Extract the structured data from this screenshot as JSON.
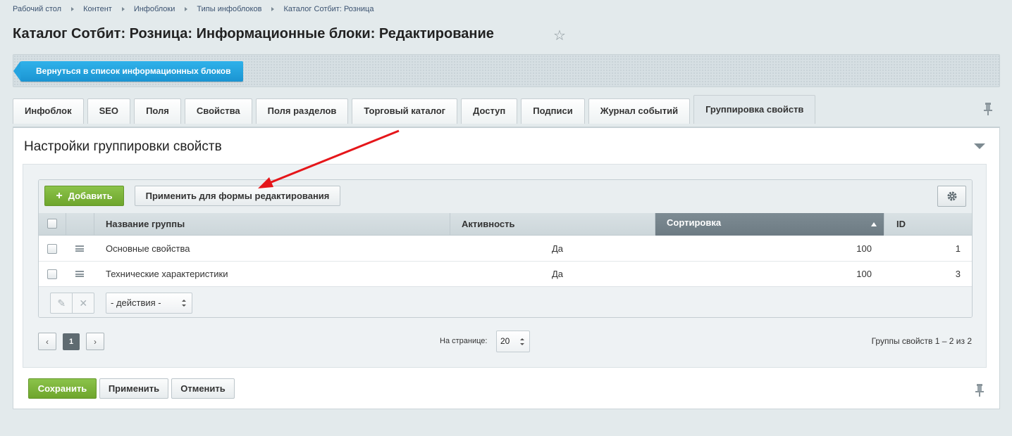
{
  "breadcrumb": [
    "Рабочий стол",
    "Контент",
    "Инфоблоки",
    "Типы инфоблоков",
    "Каталог Сотбит: Розница"
  ],
  "page_title": "Каталог Сотбит: Розница: Информационные блоки: Редактирование",
  "toolbar": {
    "back_label": "Вернуться в список информационных блоков"
  },
  "tabs": [
    {
      "label": "Инфоблок"
    },
    {
      "label": "SEO"
    },
    {
      "label": "Поля"
    },
    {
      "label": "Свойства"
    },
    {
      "label": "Поля разделов"
    },
    {
      "label": "Торговый каталог"
    },
    {
      "label": "Доступ"
    },
    {
      "label": "Подписи"
    },
    {
      "label": "Журнал событий"
    },
    {
      "label": "Группировка свойств",
      "active": true
    }
  ],
  "panel": {
    "title": "Настройки группировки свойств"
  },
  "grid": {
    "add_label": "Добавить",
    "apply_form_label": "Применить для формы редактирования",
    "columns": [
      "Название группы",
      "Активность",
      "Сортировка",
      "ID"
    ],
    "sorted_column": "Сортировка",
    "rows": [
      {
        "name": "Основные свойства",
        "active": "Да",
        "sort": "100",
        "id": "1"
      },
      {
        "name": "Технические характеристики",
        "active": "Да",
        "sort": "100",
        "id": "3"
      }
    ],
    "actions_select": "- действия -"
  },
  "pagination": {
    "current_page": "1",
    "per_page_label": "На странице:",
    "per_page_value": "20",
    "total": "Группы свойств 1 – 2 из 2"
  },
  "buttons": {
    "save": "Сохранить",
    "apply": "Применить",
    "cancel": "Отменить"
  },
  "colors": {
    "accent_blue": "#1b94d2",
    "green": "#6ea52c",
    "annotation_arrow": "#e5161a"
  },
  "icons": [
    "star-icon",
    "pin-icon",
    "collapse-icon",
    "plus-icon",
    "gear-icon",
    "drag-handle-icon",
    "edit-icon",
    "delete-icon",
    "chevron-left-icon",
    "chevron-right-icon"
  ]
}
